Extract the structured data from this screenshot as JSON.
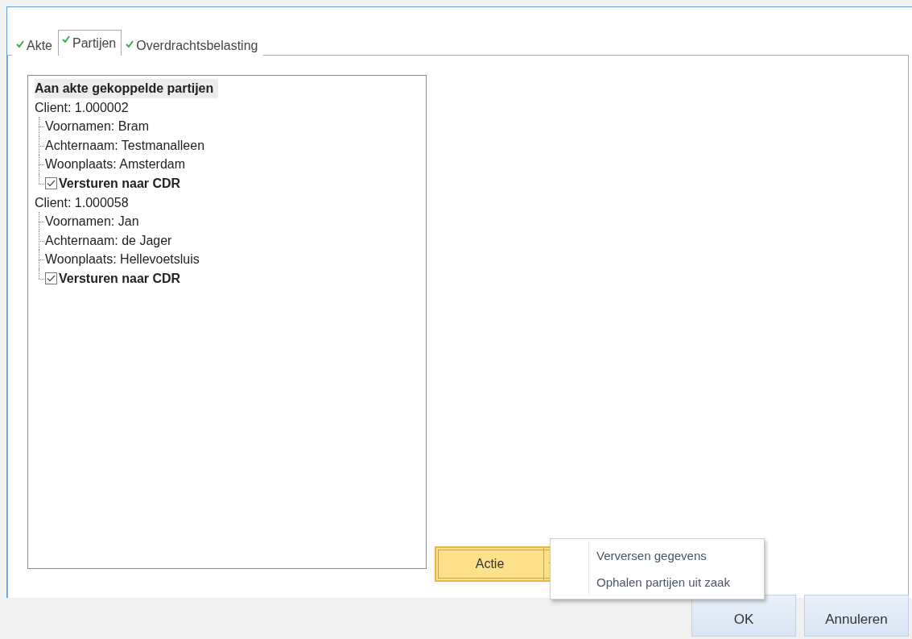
{
  "tabs": [
    {
      "label": "Akte",
      "selected": false,
      "checked": true
    },
    {
      "label": "Partijen",
      "selected": true,
      "checked": true
    },
    {
      "label": "Overdrachtsbelasting",
      "selected": false,
      "checked": true
    }
  ],
  "tree": {
    "title": "Aan akte gekoppelde partijen",
    "clients": [
      {
        "label": "Client: 1.000002",
        "children": [
          {
            "kind": "field",
            "label": "Voornamen: Bram"
          },
          {
            "kind": "field",
            "label": "Achternaam: Testmanalleen"
          },
          {
            "kind": "field",
            "label": "Woonplaats: Amsterdam"
          },
          {
            "kind": "checkbox",
            "label": "Versturen naar CDR",
            "checked": true
          }
        ]
      },
      {
        "label": "Client: 1.000058",
        "children": [
          {
            "kind": "field",
            "label": "Voornamen: Jan"
          },
          {
            "kind": "field",
            "label": "Achternaam: de Jager"
          },
          {
            "kind": "field",
            "label": "Woonplaats: Hellevoetsluis"
          },
          {
            "kind": "checkbox",
            "label": "Versturen naar CDR",
            "checked": true
          }
        ]
      }
    ]
  },
  "action_button": {
    "label": "Actie"
  },
  "menu": {
    "items": [
      "Verversen gegevens",
      "Ophalen partijen uit zaak"
    ]
  },
  "buttons": [
    "OK",
    "Annuleren"
  ]
}
